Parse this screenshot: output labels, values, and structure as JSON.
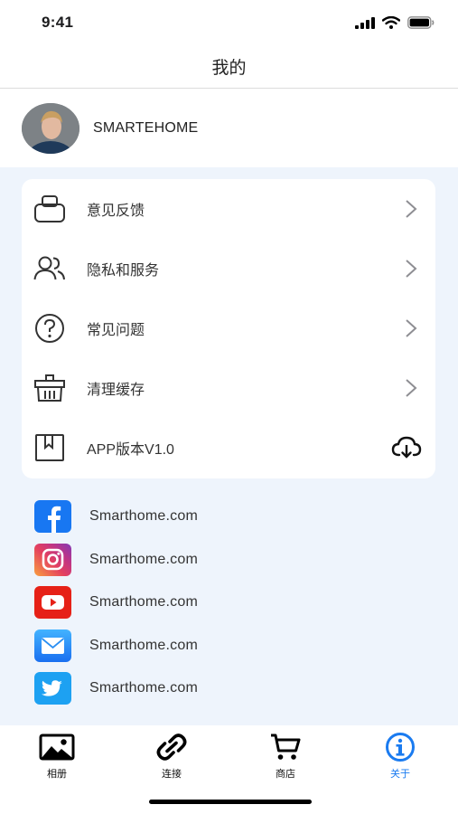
{
  "status_bar": {
    "time": "9:41",
    "icons": [
      "signal-icon",
      "wifi-icon",
      "battery-icon"
    ]
  },
  "header": {
    "title": "我的"
  },
  "profile": {
    "name": "SMARTEHOME"
  },
  "menu": {
    "items": [
      {
        "label": "意见反馈",
        "icon": "feedback-icon",
        "trailing": "chevron-right-icon"
      },
      {
        "label": "隐私和服务",
        "icon": "users-icon",
        "trailing": "chevron-right-icon"
      },
      {
        "label": "常见问题",
        "icon": "question-icon",
        "trailing": "chevron-right-icon"
      },
      {
        "label": "清理缓存",
        "icon": "basket-icon",
        "trailing": "chevron-right-icon"
      },
      {
        "label": "APP版本V1.0",
        "icon": "bookmark-icon",
        "trailing": "cloud-download-icon"
      }
    ]
  },
  "social": {
    "items": [
      {
        "label": "Smarthome.com",
        "icon": "facebook-icon",
        "color": "#1877f2"
      },
      {
        "label": "Smarthome.com",
        "icon": "instagram-icon",
        "color": "#d6249f"
      },
      {
        "label": "Smarthome.com",
        "icon": "youtube-icon",
        "color": "#e62117"
      },
      {
        "label": "Smarthome.com",
        "icon": "mail-icon",
        "color": "#1e8cf0"
      },
      {
        "label": "Smarthome.com",
        "icon": "twitter-icon",
        "color": "#1da1f2"
      }
    ]
  },
  "tabs": {
    "items": [
      {
        "label": "相册",
        "icon": "photo-icon",
        "active": false
      },
      {
        "label": "连接",
        "icon": "link-icon",
        "active": false
      },
      {
        "label": "商店",
        "icon": "cart-icon",
        "active": false
      },
      {
        "label": "关于",
        "icon": "info-icon",
        "active": true
      }
    ]
  },
  "colors": {
    "accent": "#1a7bf0",
    "content_background": "#eef4fc",
    "card_background": "#ffffff"
  }
}
